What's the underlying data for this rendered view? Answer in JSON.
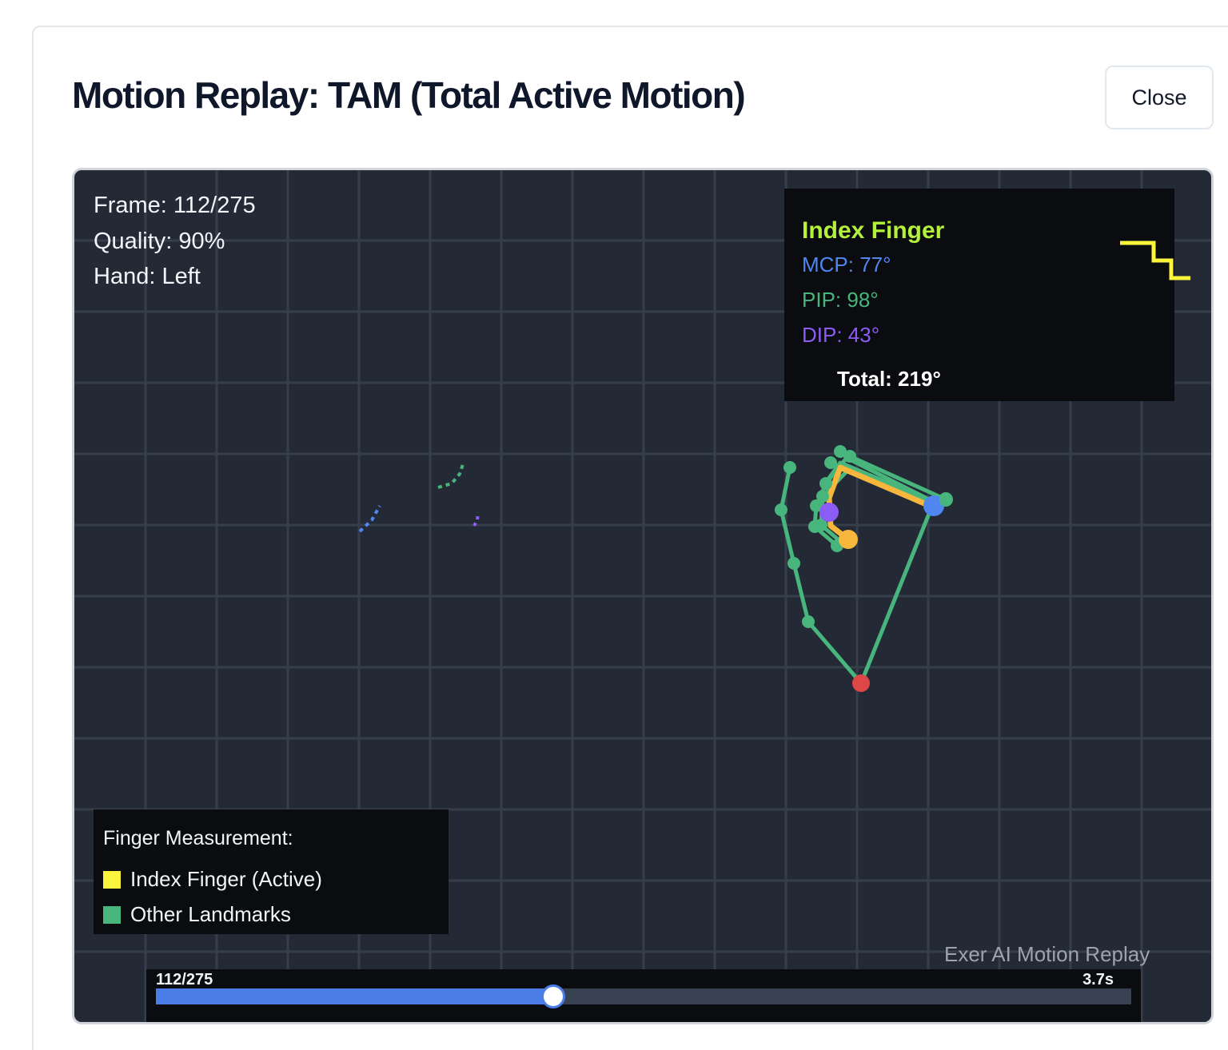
{
  "title": "Motion Replay: TAM (Total Active Motion)",
  "close_label": "Close",
  "frame": {
    "text": "Frame: 112/275",
    "current": 112,
    "total": 275
  },
  "quality_text": "Quality: 90%",
  "hand_text": "Hand: Left",
  "angles": {
    "heading": "Index Finger",
    "mcp": "MCP: 77°",
    "pip": "PIP: 98°",
    "dip": "DIP: 43°",
    "total": "Total: 219°"
  },
  "legend": {
    "heading": "Finger Measurement:",
    "items": [
      {
        "label": "Index Finger (Active)",
        "color": "#fbf43c"
      },
      {
        "label": "Other Landmarks",
        "color": "#48b57d"
      }
    ]
  },
  "watermark": "Exer AI Motion Replay",
  "timeline": {
    "position_label": "112/275",
    "duration_label": "3.7s",
    "progress": 0.407
  },
  "colors": {
    "canvas_bg": "#232a36",
    "grid": "#363d4b",
    "landmark_green": "#48b57d",
    "active_finger": "#f6b73c",
    "mcp": "#4f86f0",
    "pip": "#48b57d",
    "dip": "#8b5cf6",
    "wrist": "#dd4747",
    "accent_blue": "#4a7de8"
  }
}
